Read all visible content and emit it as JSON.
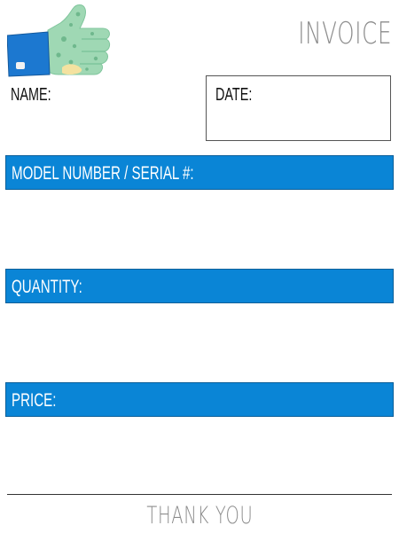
{
  "header": {
    "title": "INVOICE",
    "logo_icon": "thumbs-up-icon"
  },
  "fields": {
    "name_label": "NAME:",
    "date_label": "DATE:"
  },
  "sections": [
    {
      "label": "MODEL NUMBER / SERIAL #:",
      "value": ""
    },
    {
      "label": "QUANTITY:",
      "value": ""
    },
    {
      "label": "PRICE:",
      "value": ""
    }
  ],
  "footer": {
    "text": "THANK YOU"
  },
  "colors": {
    "accent": "#0a85d6",
    "title_gray": "#8c8c8c",
    "cuff_blue": "#1c78d0",
    "hand_green": "#9fd8b4"
  }
}
